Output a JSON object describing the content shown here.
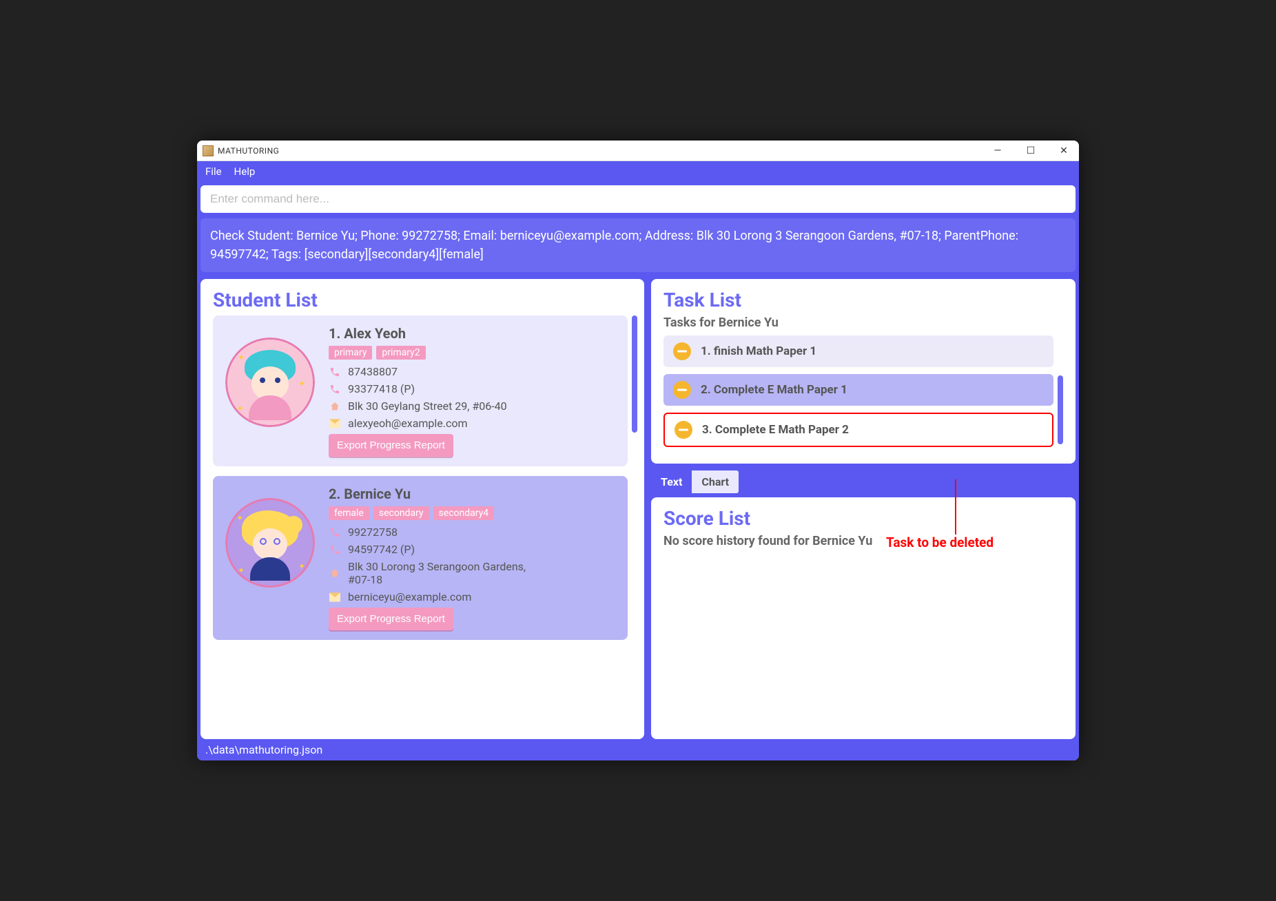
{
  "window": {
    "title": "MATHUTORING"
  },
  "menubar": {
    "file": "File",
    "help": "Help"
  },
  "command": {
    "placeholder": "Enter command here..."
  },
  "output": "Check Student: Bernice Yu; Phone: 99272758; Email: berniceyu@example.com; Address: Blk 30 Lorong 3 Serangoon Gardens, #07-18; ParentPhone: 94597742; Tags: [secondary][secondary4][female]",
  "sidebar": {
    "title": "Student List",
    "students": [
      {
        "label": "1.  Alex Yeoh",
        "tags": [
          "primary",
          "primary2"
        ],
        "phone": "87438807",
        "parent_phone": "93377418 (P)",
        "address": "Blk 30 Geylang Street 29, #06-40",
        "email": "alexyeoh@example.com",
        "export": "Export Progress Report"
      },
      {
        "label": "2.  Bernice Yu",
        "tags": [
          "female",
          "secondary",
          "secondary4"
        ],
        "phone": "99272758",
        "parent_phone": "94597742 (P)",
        "address": "Blk 30 Lorong 3 Serangoon Gardens, #07-18",
        "email": "berniceyu@example.com",
        "export": "Export Progress Report"
      }
    ]
  },
  "tasks": {
    "title": "Task List",
    "subtitle": "Tasks for Bernice Yu",
    "items": [
      {
        "label": "1. finish Math Paper 1"
      },
      {
        "label": "2. Complete E Math Paper 1"
      },
      {
        "label": "3. Complete E Math Paper 2"
      }
    ]
  },
  "tabs": {
    "text": "Text",
    "chart": "Chart"
  },
  "score": {
    "title": "Score List",
    "empty": "No score history found for Bernice Yu"
  },
  "status": {
    "path": ".\\data\\mathutoring.json"
  },
  "annotation": {
    "label": "Task to be deleted"
  }
}
